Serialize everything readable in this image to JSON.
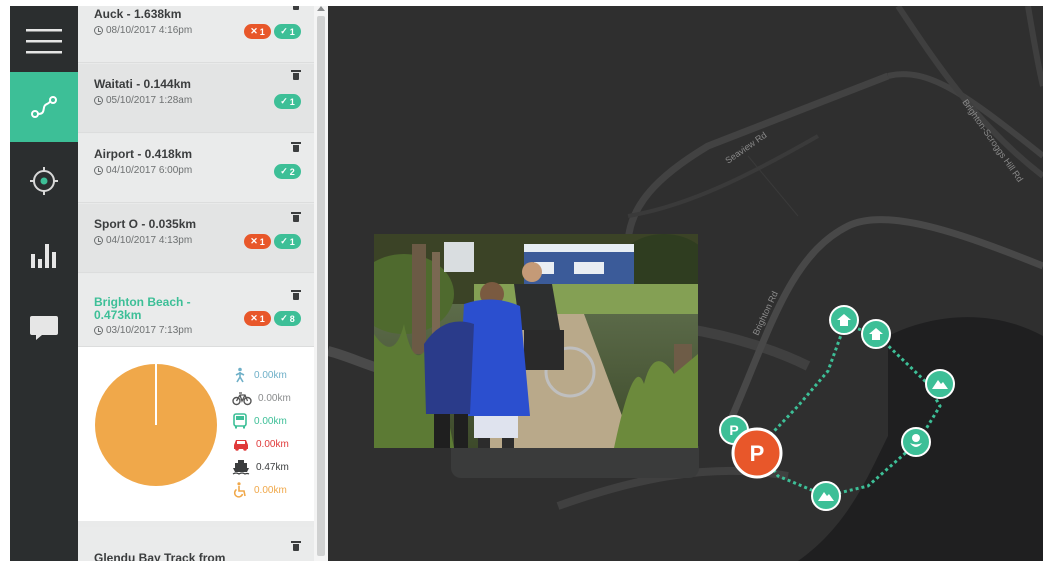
{
  "trips": [
    {
      "title": "Auck - 1.638km",
      "date": "08/10/2017 4:16pm",
      "errors": "1",
      "checks": "1"
    },
    {
      "title": "Waitati - 0.144km",
      "date": "05/10/2017 1:28am",
      "checks": "1"
    },
    {
      "title": "Airport - 0.418km",
      "date": "04/10/2017 6:00pm",
      "checks": "2"
    },
    {
      "title": "Sport O - 0.035km",
      "date": "04/10/2017 4:13pm",
      "errors": "1",
      "checks": "1"
    },
    {
      "title": "Brighton Beach - 0.473km",
      "date": "03/10/2017 7:13pm",
      "errors": "1",
      "checks": "8"
    },
    {
      "title": "Glendu Bay Track from"
    }
  ],
  "detail": {
    "modes": [
      {
        "icon": "walk-icon",
        "value": "0.00km",
        "color": "#6fb0c8"
      },
      {
        "icon": "bike-icon",
        "value": "0.00km",
        "color": "#8a8c8d"
      },
      {
        "icon": "bus-icon",
        "value": "0.00km",
        "color": "#3dbf97"
      },
      {
        "icon": "car-icon",
        "value": "0.00km",
        "color": "#e03a3a"
      },
      {
        "icon": "ferry-icon",
        "value": "0.47km",
        "color": "#3b3d3e"
      },
      {
        "icon": "wheelchair-icon",
        "value": "0.00km",
        "color": "#f0a84a"
      }
    ],
    "pie_color": "#f0a84a"
  },
  "map": {
    "roads": [
      "Seaview Rd",
      "Brighton Rd",
      "Brighton-Scroggs Hill Rd"
    ]
  },
  "colors": {
    "accent": "#3dbf97",
    "error": "#e8572a",
    "parking": "#e8572a"
  }
}
